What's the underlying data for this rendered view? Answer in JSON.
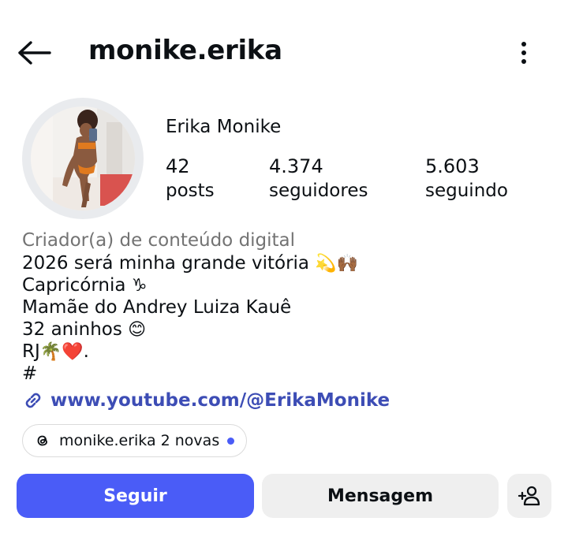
{
  "header": {
    "username": "monike.erika",
    "back_icon": "arrow-left-icon",
    "more_icon": "more-vertical-icon"
  },
  "profile": {
    "display_name": "Erika Monike",
    "stats": {
      "posts_count": "42",
      "posts_label": "posts",
      "followers_count": "4.374",
      "followers_label": "seguidores",
      "following_count": "5.603",
      "following_label": "seguindo"
    }
  },
  "bio": {
    "category": "Criador(a) de conteúdo digital",
    "line1_text": "2026 será minha grande vitória",
    "line1_emoji": "💫🙌🏾",
    "line2_text": "Capricórnia",
    "line2_emoji": "♑",
    "line3_text": "Mamãe do Andrey Luiza Kauê",
    "line4_text": "32 aninhos",
    "line4_emoji": "😊",
    "line5_text": "RJ",
    "line5_emoji": "🌴❤️",
    "line5_suffix": ".",
    "line6_text": "#"
  },
  "link": {
    "icon": "link-icon",
    "text": "www.youtube.com/@ErikaMonike"
  },
  "threads": {
    "icon": "threads-icon",
    "text": "monike.erika 2 novas"
  },
  "actions": {
    "follow_label": "Seguir",
    "message_label": "Mensagem",
    "suggest_icon": "add-person-icon"
  },
  "colors": {
    "accent": "#4a5cf7",
    "link": "#3d4db5",
    "secondary_text": "#737373",
    "button_gray": "#efefef"
  }
}
